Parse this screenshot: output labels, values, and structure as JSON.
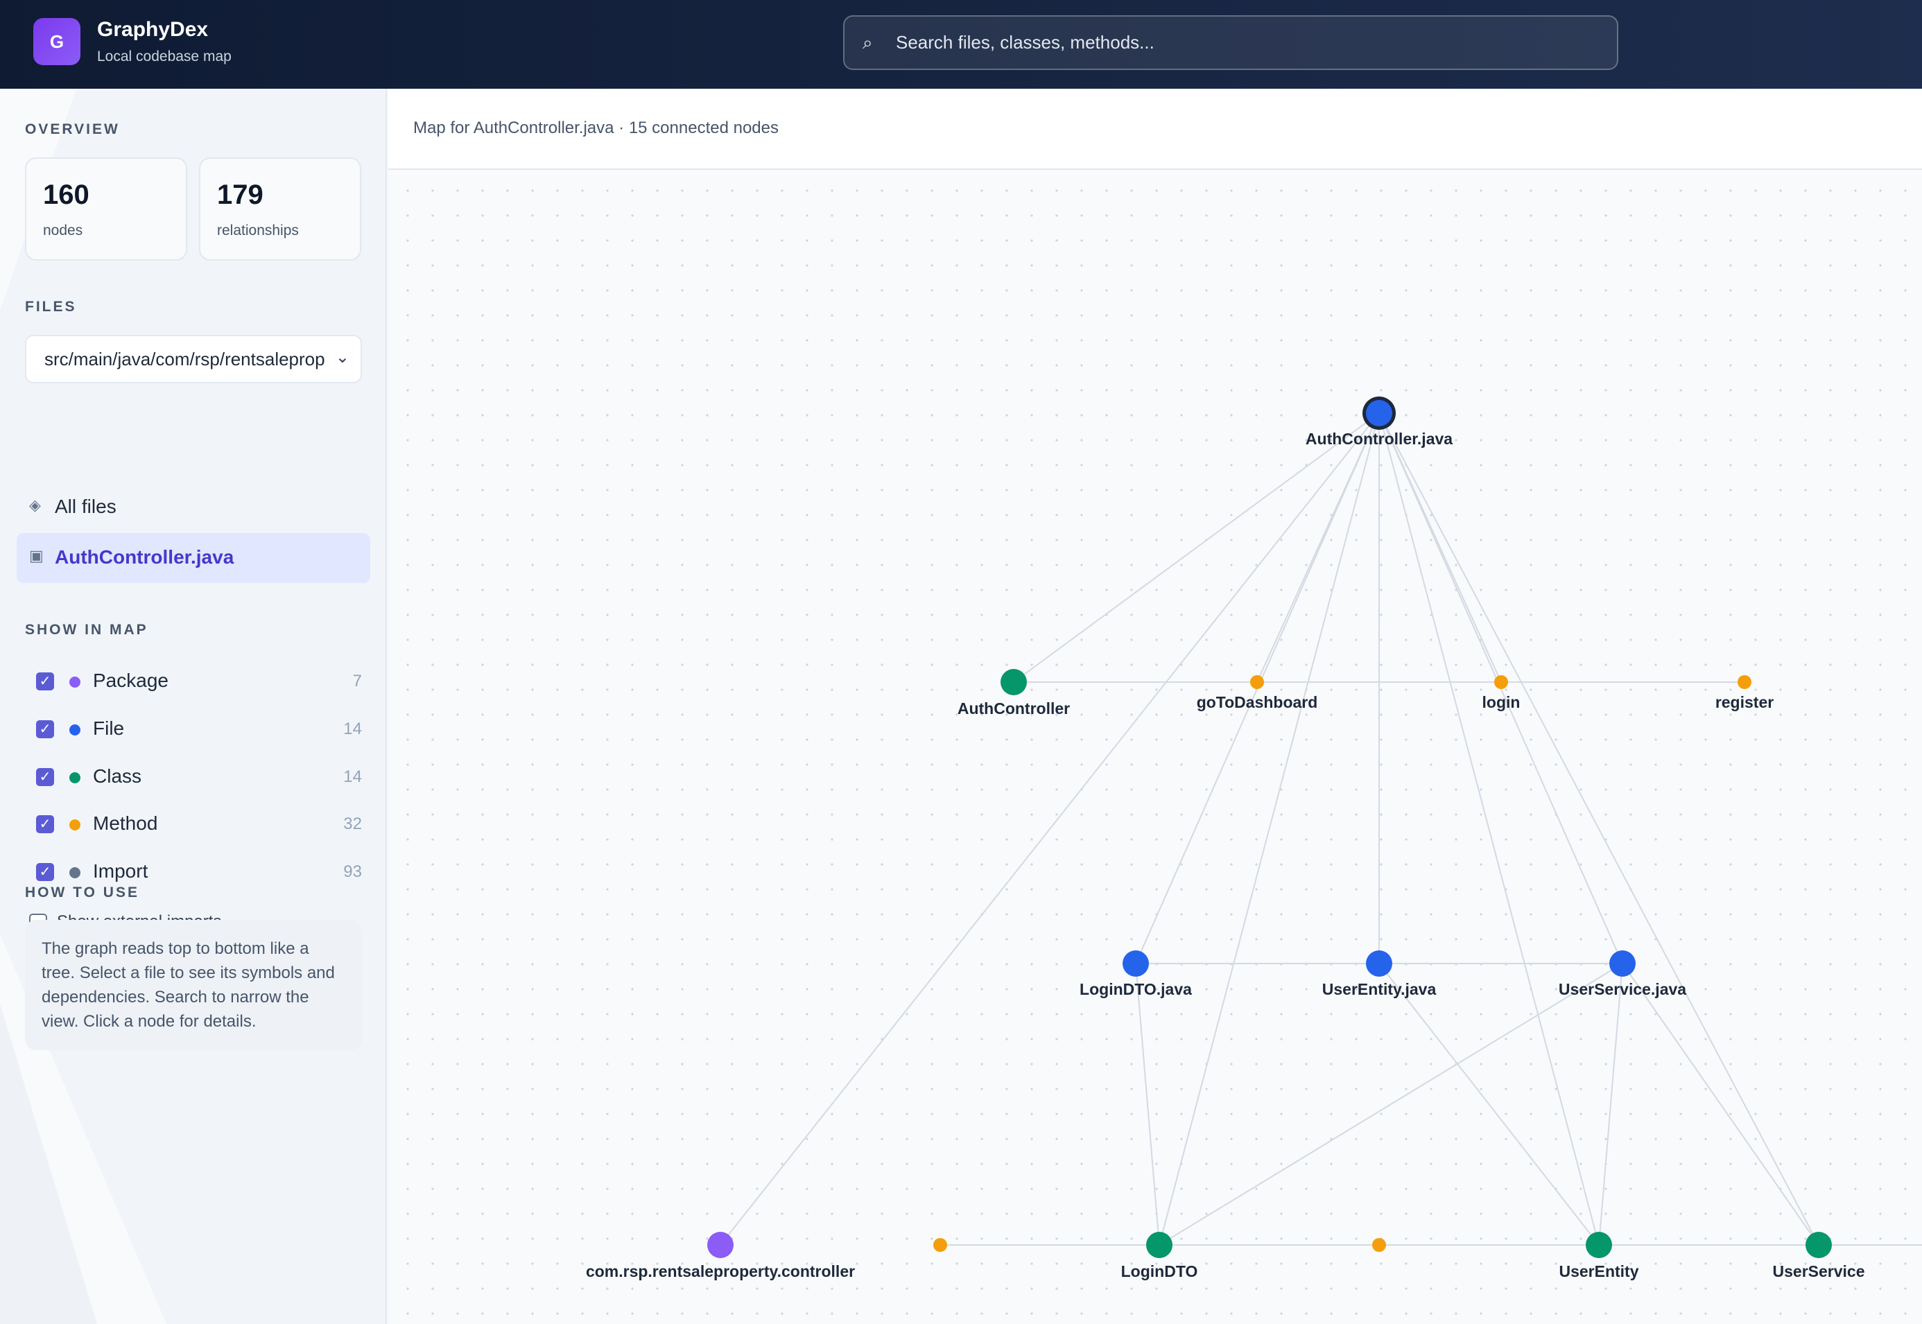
{
  "header": {
    "logo_letter": "G",
    "title": "GraphyDex",
    "subtitle": "Local codebase map",
    "search_placeholder": "Search files, classes, methods...",
    "search_icon": "search-icon"
  },
  "sidebar": {
    "overview_title": "OVERVIEW",
    "stats": [
      {
        "value": "160",
        "label": "nodes"
      },
      {
        "value": "179",
        "label": "relationships"
      }
    ],
    "files_title": "FILES",
    "file_select_value": "src/main/java/com/rsp/rentsaleprop",
    "nav": [
      {
        "label": "All files",
        "icon": "diamond-icon",
        "active": false
      },
      {
        "label": "AuthController.java",
        "icon": "file-icon",
        "active": true
      }
    ],
    "show_title": "SHOW IN MAP",
    "filters": [
      {
        "label": "Package",
        "count": "7",
        "color": "#8b5cf6",
        "checked": true
      },
      {
        "label": "File",
        "count": "14",
        "color": "#2563eb",
        "checked": true
      },
      {
        "label": "Class",
        "count": "14",
        "color": "#059669",
        "checked": true
      },
      {
        "label": "Method",
        "count": "32",
        "color": "#f59e0b",
        "checked": true
      },
      {
        "label": "Import",
        "count": "93",
        "color": "#64748b",
        "checked": true
      }
    ],
    "external_imports_label": "Show external imports",
    "howto_title": "HOW TO USE",
    "howto_text": "The graph reads top to bottom like a tree. Select a file to see its symbols and dependencies. Search to narrow the view. Click a node for details."
  },
  "main": {
    "caption": "Map for AuthController.java · 15 connected nodes"
  },
  "graph": {
    "colors": {
      "file": "#2563eb",
      "class": "#059669",
      "method": "#f59e0b",
      "package": "#8b5cf6",
      "edge": "#d4d9e2"
    },
    "nodes": [
      {
        "id": "authctl_java",
        "label": "AuthController.java",
        "type": "file",
        "selected": true
      },
      {
        "id": "authctl",
        "label": "AuthController",
        "type": "class"
      },
      {
        "id": "gotodash",
        "label": "goToDashboard",
        "type": "method"
      },
      {
        "id": "login",
        "label": "login",
        "type": "method"
      },
      {
        "id": "register",
        "label": "register",
        "type": "method"
      },
      {
        "id": "logindto_java",
        "label": "LoginDTO.java",
        "type": "file"
      },
      {
        "id": "userentity_java",
        "label": "UserEntity.java",
        "type": "file"
      },
      {
        "id": "userservice_java",
        "label": "UserService.java",
        "type": "file"
      },
      {
        "id": "pkg",
        "label": "com.rsp.rentsaleproperty.controller",
        "type": "package"
      },
      {
        "id": "m1",
        "label": "",
        "type": "method"
      },
      {
        "id": "logindto",
        "label": "LoginDTO",
        "type": "class"
      },
      {
        "id": "m2",
        "label": "",
        "type": "method"
      },
      {
        "id": "userentity",
        "label": "UserEntity",
        "type": "class"
      },
      {
        "id": "userservice",
        "label": "UserService",
        "type": "class"
      }
    ],
    "edges": [
      [
        "authctl_java",
        "authctl"
      ],
      [
        "authctl_java",
        "gotodash"
      ],
      [
        "authctl_java",
        "login"
      ],
      [
        "authctl_java",
        "logindto_java"
      ],
      [
        "authctl_java",
        "userentity_java"
      ],
      [
        "authctl_java",
        "userservice_java"
      ],
      [
        "authctl_java",
        "pkg"
      ],
      [
        "authctl_java",
        "logindto"
      ],
      [
        "authctl_java",
        "userentity"
      ],
      [
        "authctl_java",
        "userservice"
      ],
      [
        "authctl",
        "gotodash"
      ],
      [
        "gotodash",
        "login"
      ],
      [
        "login",
        "register"
      ],
      [
        "logindto_java",
        "userentity_java"
      ],
      [
        "userentity_java",
        "userservice_java"
      ],
      [
        "logindto_java",
        "logindto"
      ],
      [
        "userentity_java",
        "userentity"
      ],
      [
        "userservice_java",
        "userentity"
      ],
      [
        "userservice_java",
        "userservice"
      ],
      [
        "userservice_java",
        "logindto"
      ],
      [
        "m1",
        "logindto"
      ],
      [
        "logindto",
        "m2"
      ],
      [
        "m2",
        "userentity"
      ],
      [
        "userentity",
        "userservice"
      ],
      [
        "userservice",
        "offscreen"
      ]
    ]
  }
}
